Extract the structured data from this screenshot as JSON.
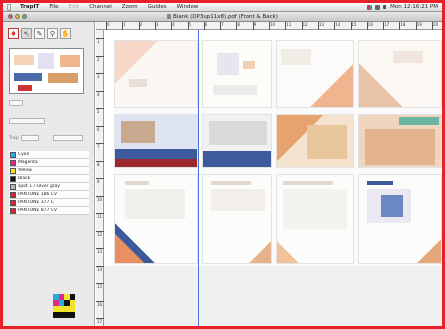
{
  "menubar": {
    "app_name": "TrapIT",
    "menus": [
      "File",
      "Edit",
      "Channel",
      "Zoom",
      "Guides",
      "Window"
    ],
    "clock": "Mon 12:16:21 PM"
  },
  "window": {
    "title": "Blank (DP3up11x8).pdf (Front & Back)"
  },
  "ruler": {
    "x_labels": [
      "0",
      "1",
      "2",
      "3",
      "4",
      "5",
      "6",
      "7",
      "8",
      "9",
      "10",
      "11",
      "12",
      "13",
      "14",
      "15",
      "16",
      "17",
      "18",
      "19",
      "20"
    ],
    "y_labels": [
      "1",
      "2",
      "3",
      "4",
      "5",
      "6",
      "7",
      "8",
      "9",
      "10",
      "11",
      "12",
      "13",
      "14",
      "15",
      "16",
      "17"
    ]
  },
  "panel": {
    "field_label_1": "Trap",
    "separations": [
      {
        "name": "Cyan",
        "color": "#2aa8e0"
      },
      {
        "name": "Magenta",
        "color": "#e02a8a"
      },
      {
        "name": "Yellow",
        "color": "#f2e22a"
      },
      {
        "name": "Black",
        "color": "#111111"
      },
      {
        "name": "spot 1 / silver gray",
        "color": "#b9b9b9"
      },
      {
        "name": "PANTONE 186 CV",
        "color": "#d8233b"
      },
      {
        "name": "PANTONE 377 C",
        "color": "#d8233b"
      },
      {
        "name": "PANTONE 877 CV",
        "color": "#d8233b"
      }
    ]
  },
  "colors": {
    "frame": "#e8202a",
    "guide": "#4a78d8"
  }
}
